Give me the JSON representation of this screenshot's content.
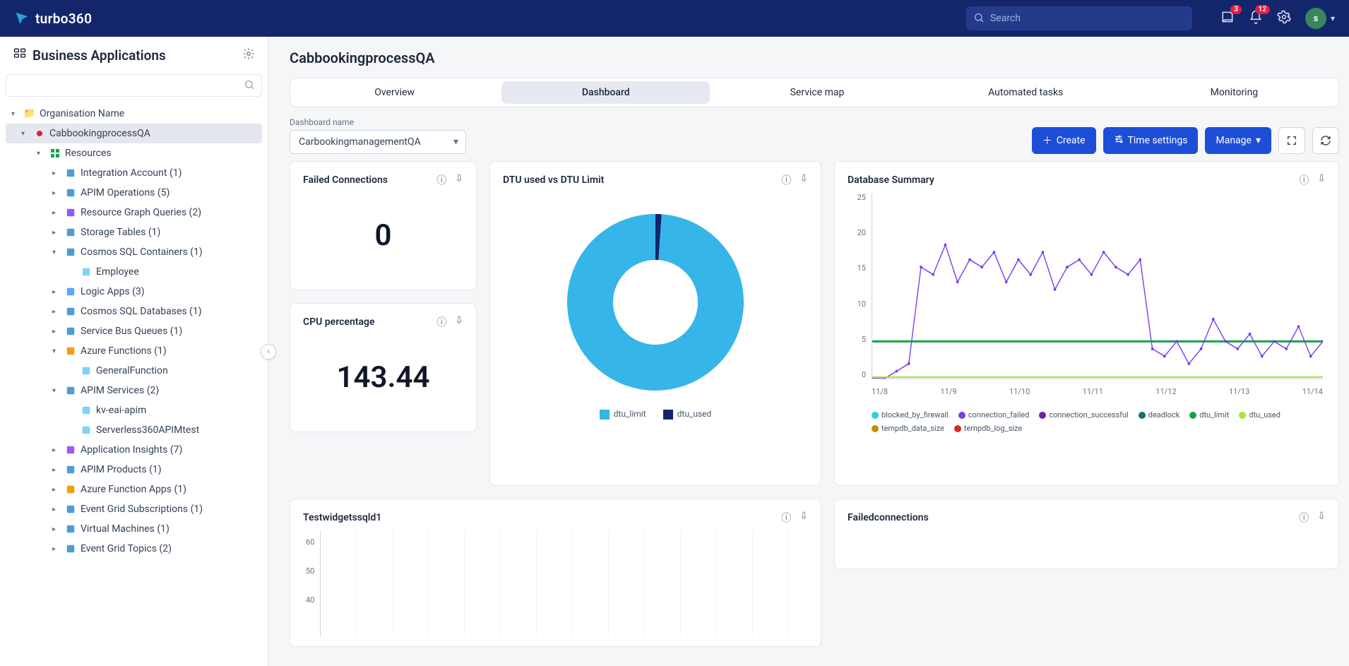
{
  "brand": "turbo360",
  "search": {
    "placeholder": "Search"
  },
  "badges": {
    "notif1": "3",
    "notif2": "12"
  },
  "avatar": "s",
  "side_header": "Business Applications",
  "tree": {
    "org": "Organisation Name",
    "app": "CabbookingprocessQA",
    "resources": "Resources",
    "items": [
      {
        "label": "Integration Account (1)",
        "exp": false
      },
      {
        "label": "APIM Operations (5)",
        "exp": false
      },
      {
        "label": "Resource Graph Queries (2)",
        "exp": false
      },
      {
        "label": "Storage Tables (1)",
        "exp": false
      },
      {
        "label": "Cosmos SQL Containers (1)",
        "exp": true,
        "children": [
          {
            "label": "Employee"
          }
        ]
      },
      {
        "label": "Logic Apps (3)",
        "exp": false
      },
      {
        "label": "Cosmos SQL Databases (1)",
        "exp": false
      },
      {
        "label": "Service Bus Queues (1)",
        "exp": false
      },
      {
        "label": "Azure Functions (1)",
        "exp": true,
        "children": [
          {
            "label": "GeneralFunction"
          }
        ]
      },
      {
        "label": "APIM Services (2)",
        "exp": true,
        "children": [
          {
            "label": "kv-eai-apim"
          },
          {
            "label": "Serverless360APIMtest"
          }
        ]
      },
      {
        "label": "Application Insights (7)",
        "exp": false
      },
      {
        "label": "APIM Products (1)",
        "exp": false
      },
      {
        "label": "Azure Function Apps (1)",
        "exp": false
      },
      {
        "label": "Event Grid Subscriptions (1)",
        "exp": false
      },
      {
        "label": "Virtual Machines (1)",
        "exp": false
      },
      {
        "label": "Event Grid Topics (2)",
        "exp": false
      }
    ]
  },
  "page_title": "CabbookingprocessQA",
  "tabs": [
    "Overview",
    "Dashboard",
    "Service map",
    "Automated tasks",
    "Monitoring"
  ],
  "active_tab": "Dashboard",
  "dropdown": {
    "label": "Dashboard name",
    "value": "CarbookingmanagementQA"
  },
  "buttons": {
    "create": "Create",
    "time": "Time settings",
    "manage": "Manage"
  },
  "widgets": {
    "failed": {
      "title": "Failed Connections",
      "value": "0"
    },
    "cpu": {
      "title": "CPU percentage",
      "value": "143.44"
    },
    "dtu": {
      "title": "DTU used vs DTU Limit",
      "legend1": "dtu_limit",
      "legend2": "dtu_used"
    },
    "db": {
      "title": "Database Summary"
    },
    "lw": {
      "title": "Testwidgetssqld1"
    },
    "fc": {
      "title": "Failedconnections"
    }
  },
  "chart_data": [
    {
      "type": "pie",
      "title": "DTU used vs DTU Limit",
      "series": [
        {
          "name": "dtu_limit",
          "value": 99,
          "color": "#36b5e8"
        },
        {
          "name": "dtu_used",
          "value": 1,
          "color": "#14266b"
        }
      ]
    },
    {
      "type": "line",
      "title": "Database Summary",
      "x_ticks": [
        "11/8",
        "11/9",
        "11/10",
        "11/11",
        "11/12",
        "11/13",
        "11/14"
      ],
      "y_ticks": [
        0,
        5,
        10,
        15,
        20,
        25
      ],
      "ylim": [
        0,
        25
      ],
      "series": [
        {
          "name": "blocked_by_firewall",
          "color": "#22d3ee",
          "values": [
            0,
            0,
            0,
            0,
            0,
            0,
            0
          ]
        },
        {
          "name": "connection_failed",
          "color": "#7c3aed",
          "values": [
            0,
            1,
            15,
            16,
            15,
            3,
            4
          ]
        },
        {
          "name": "connection_successful",
          "color": "#6b21a8",
          "values": [
            0,
            0,
            0,
            0,
            0,
            0,
            0
          ]
        },
        {
          "name": "deadlock",
          "color": "#0f766e",
          "values": [
            0,
            0,
            0,
            0,
            0,
            0,
            0
          ]
        },
        {
          "name": "dtu_limit",
          "color": "#16a34a",
          "values": [
            5,
            5,
            5,
            5,
            5,
            5,
            5
          ]
        },
        {
          "name": "dtu_used",
          "color": "#a3e635",
          "values": [
            0,
            0,
            0,
            0,
            0,
            0,
            0
          ]
        },
        {
          "name": "tempdb_data_size",
          "color": "#ca8a04",
          "values": [
            0,
            0,
            0,
            0,
            0,
            0,
            0
          ]
        },
        {
          "name": "tempdb_log_size",
          "color": "#dc2626",
          "values": [
            0,
            0,
            0,
            0,
            0,
            0,
            0
          ]
        }
      ]
    },
    {
      "type": "line",
      "title": "Testwidgetssqld1",
      "y_ticks": [
        40,
        50,
        60
      ],
      "series": []
    }
  ]
}
